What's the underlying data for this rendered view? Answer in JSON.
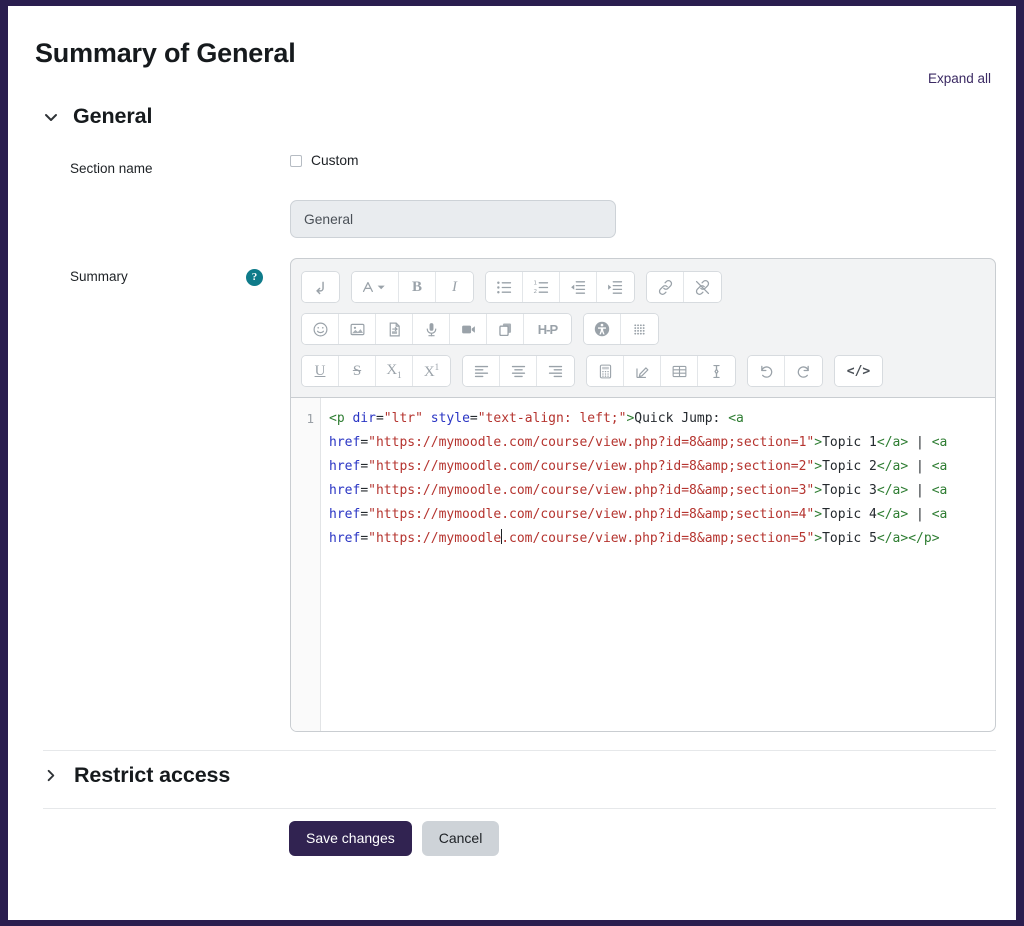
{
  "page": {
    "title": "Summary of General",
    "expand_all_label": "Expand all",
    "accent_purple": "#312351",
    "frame_border_color": "#2a1e4f",
    "help_icon_color": "#0f7b8a"
  },
  "general_section": {
    "title": "General",
    "chevron_icon": "chevron-down-icon",
    "expanded": true
  },
  "fields": {
    "section_name": {
      "label": "Section name",
      "custom_checkbox_label": "Custom",
      "custom_checked": false,
      "input_value": "General",
      "input_placeholder": "Section name",
      "input_disabled": true
    },
    "summary": {
      "label": "Summary",
      "help_icon": "question-mark-icon",
      "help_label": "?"
    }
  },
  "editor": {
    "toolbar_rows": [
      {
        "groups": [
          {
            "buttons": [
              {
                "name": "line-break-icon",
                "title": "Insert line break"
              }
            ]
          },
          {
            "buttons": [
              {
                "name": "font-style-dropdown-icon",
                "title": "Paragraph styles"
              },
              {
                "name": "bold-icon",
                "title": "Bold"
              },
              {
                "name": "italic-icon",
                "title": "Italic"
              }
            ]
          },
          {
            "buttons": [
              {
                "name": "bulleted-list-icon",
                "title": "Bulleted list"
              },
              {
                "name": "numbered-list-icon",
                "title": "Numbered list"
              },
              {
                "name": "outdent-icon",
                "title": "Decrease indent"
              },
              {
                "name": "indent-icon",
                "title": "Increase indent"
              }
            ]
          },
          {
            "buttons": [
              {
                "name": "link-icon",
                "title": "Insert link"
              },
              {
                "name": "unlink-icon",
                "title": "Remove link"
              }
            ]
          }
        ]
      },
      {
        "groups": [
          {
            "buttons": [
              {
                "name": "emoji-icon",
                "title": "Emoji picker"
              },
              {
                "name": "image-icon",
                "title": "Insert image"
              },
              {
                "name": "media-file-icon",
                "title": "Insert media file"
              },
              {
                "name": "microphone-icon",
                "title": "Record audio"
              },
              {
                "name": "video-camera-icon",
                "title": "Record video"
              },
              {
                "name": "manage-files-icon",
                "title": "Manage files"
              },
              {
                "name": "h5p-icon",
                "title": "Insert H5P",
                "text": "H-P"
              }
            ]
          },
          {
            "buttons": [
              {
                "name": "accessibility-checker-icon",
                "title": "Accessibility checker"
              },
              {
                "name": "screenreader-helper-icon",
                "title": "Screenreader helper"
              }
            ]
          }
        ]
      },
      {
        "groups": [
          {
            "buttons": [
              {
                "name": "underline-icon",
                "title": "Underline",
                "text": "U"
              },
              {
                "name": "strikethrough-icon",
                "title": "Strikethrough",
                "text": "S"
              },
              {
                "name": "subscript-icon",
                "title": "Subscript",
                "text": "X1"
              },
              {
                "name": "superscript-icon",
                "title": "Superscript",
                "text": "X1"
              }
            ]
          },
          {
            "buttons": [
              {
                "name": "align-left-icon",
                "title": "Align left"
              },
              {
                "name": "align-center-icon",
                "title": "Align center"
              },
              {
                "name": "align-right-icon",
                "title": "Align right"
              }
            ]
          },
          {
            "buttons": [
              {
                "name": "equation-editor-icon",
                "title": "Equation editor"
              },
              {
                "name": "chemistry-editor-icon",
                "title": "Chemistry editor"
              },
              {
                "name": "table-icon",
                "title": "Insert table"
              },
              {
                "name": "clear-formatting-icon",
                "title": "Clear formatting"
              }
            ]
          },
          {
            "buttons": [
              {
                "name": "undo-icon",
                "title": "Undo"
              },
              {
                "name": "redo-icon",
                "title": "Redo"
              }
            ]
          },
          {
            "buttons": [
              {
                "name": "html-source-icon",
                "title": "HTML source",
                "text": "</>"
              }
            ]
          }
        ]
      }
    ],
    "line_number": "1",
    "code_tokens": [
      {
        "t": "tag",
        "v": "<p"
      },
      {
        "t": "txt",
        "v": " "
      },
      {
        "t": "attr",
        "v": "dir"
      },
      {
        "t": "txt",
        "v": "="
      },
      {
        "t": "str",
        "v": "\"ltr\""
      },
      {
        "t": "txt",
        "v": " "
      },
      {
        "t": "attr",
        "v": "style"
      },
      {
        "t": "txt",
        "v": "="
      },
      {
        "t": "str",
        "v": "\"text-align: left;\""
      },
      {
        "t": "tag",
        "v": ">"
      },
      {
        "t": "txt",
        "v": "Quick Jump: "
      },
      {
        "t": "tag",
        "v": "<a"
      },
      {
        "t": "txt",
        "v": " "
      },
      {
        "t": "attr",
        "v": "href"
      },
      {
        "t": "txt",
        "v": "="
      },
      {
        "t": "str",
        "v": "\"https://mymoodle.com/course/view.php?id=8&amp;section=1\""
      },
      {
        "t": "tag",
        "v": ">"
      },
      {
        "t": "txt",
        "v": "Topic 1"
      },
      {
        "t": "tag",
        "v": "</a>"
      },
      {
        "t": "txt",
        "v": " | "
      },
      {
        "t": "tag",
        "v": "<a"
      },
      {
        "t": "txt",
        "v": " "
      },
      {
        "t": "attr",
        "v": "href"
      },
      {
        "t": "txt",
        "v": "="
      },
      {
        "t": "str",
        "v": "\"https://mymoodle.com/course/view.php?id=8&amp;section=2\""
      },
      {
        "t": "tag",
        "v": ">"
      },
      {
        "t": "txt",
        "v": "Topic 2"
      },
      {
        "t": "tag",
        "v": "</a>"
      },
      {
        "t": "txt",
        "v": " | "
      },
      {
        "t": "tag",
        "v": "<a"
      },
      {
        "t": "txt",
        "v": " "
      },
      {
        "t": "attr",
        "v": "href"
      },
      {
        "t": "txt",
        "v": "="
      },
      {
        "t": "str",
        "v": "\"https://mymoodle.com/course/view.php?id=8&amp;section=3\""
      },
      {
        "t": "tag",
        "v": ">"
      },
      {
        "t": "txt",
        "v": "Topic 3"
      },
      {
        "t": "tag",
        "v": "</a>"
      },
      {
        "t": "txt",
        "v": " | "
      },
      {
        "t": "tag",
        "v": "<a"
      },
      {
        "t": "txt",
        "v": " "
      },
      {
        "t": "attr",
        "v": "href"
      },
      {
        "t": "txt",
        "v": "="
      },
      {
        "t": "str",
        "v": "\"https://mymoodle.com/course/view.php?id=8&amp;section=4\""
      },
      {
        "t": "tag",
        "v": ">"
      },
      {
        "t": "txt",
        "v": "Topic 4"
      },
      {
        "t": "tag",
        "v": "</a>"
      },
      {
        "t": "txt",
        "v": " | "
      },
      {
        "t": "tag",
        "v": "<a"
      },
      {
        "t": "txt",
        "v": " "
      },
      {
        "t": "attr",
        "v": "href"
      },
      {
        "t": "txt",
        "v": "="
      },
      {
        "t": "str",
        "v": "\"https://mymoodle"
      },
      {
        "t": "caret",
        "v": ""
      },
      {
        "t": "str",
        "v": ".com/course/view.php?id=8&amp;section=5\""
      },
      {
        "t": "tag",
        "v": ">"
      },
      {
        "t": "txt",
        "v": "Topic 5"
      },
      {
        "t": "tag",
        "v": "</a></p>"
      }
    ],
    "syntax_colors": {
      "tag": "#2e7d32",
      "attribute": "#2a35c4",
      "string": "#b5342f",
      "text": "#24292e"
    }
  },
  "restrict_access": {
    "title": "Restrict access",
    "chevron_icon": "chevron-right-icon",
    "expanded": false
  },
  "actions": {
    "save_label": "Save changes",
    "cancel_label": "Cancel"
  }
}
